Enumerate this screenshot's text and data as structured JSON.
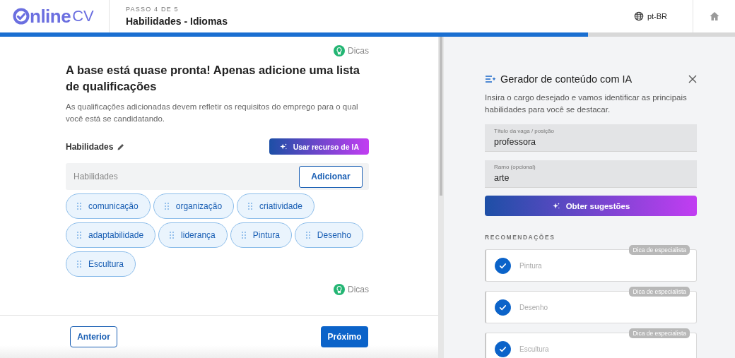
{
  "header": {
    "logo": {
      "main": "nline",
      "suffix": "CV"
    },
    "step": "PASSO 4 DE 5",
    "title": "Habilidades - Idiomas",
    "language": "pt-BR"
  },
  "progress": {
    "level": 0.8
  },
  "editor": {
    "tips": [
      "Dicas",
      "Dicas"
    ],
    "heading": "A base está quase pronta! Apenas adicione uma lista de qualificações",
    "description": "As qualificações adicionadas devem refletir os requisitos do emprego para o qual você está se candidatando.",
    "section_label": "Habilidades",
    "ai_button": "Usar recurso de IA",
    "input": {
      "placeholder": "Habilidades"
    },
    "add_button": "Adicionar",
    "skills": [
      "comunicação",
      "organização",
      "criatividade",
      "adaptabilidade",
      "liderança",
      "Pintura",
      "Desenho",
      "Escultura"
    ]
  },
  "footer": {
    "back": "Anterior",
    "next": "Próximo"
  },
  "ai_panel": {
    "title": "Gerador de conteúdo com IA",
    "description": "Insira o cargo desejado e vamos identificar as principais habilidades para você se destacar.",
    "fields": [
      {
        "label": "Título da vaga / posição",
        "value": "professora"
      },
      {
        "label": "Ramo (opcional)",
        "value": "arte"
      }
    ],
    "button": "Obter sugestões",
    "recommendations_title": "RECOMENDAÇÕES",
    "recommendations": [
      {
        "text": "Pintura",
        "badge": "Dica de especialista",
        "checked": true
      },
      {
        "text": "Desenho",
        "badge": "Dica de especialista",
        "checked": true
      },
      {
        "text": "Escultura",
        "badge": "Dica de especialista",
        "checked": true
      }
    ]
  }
}
